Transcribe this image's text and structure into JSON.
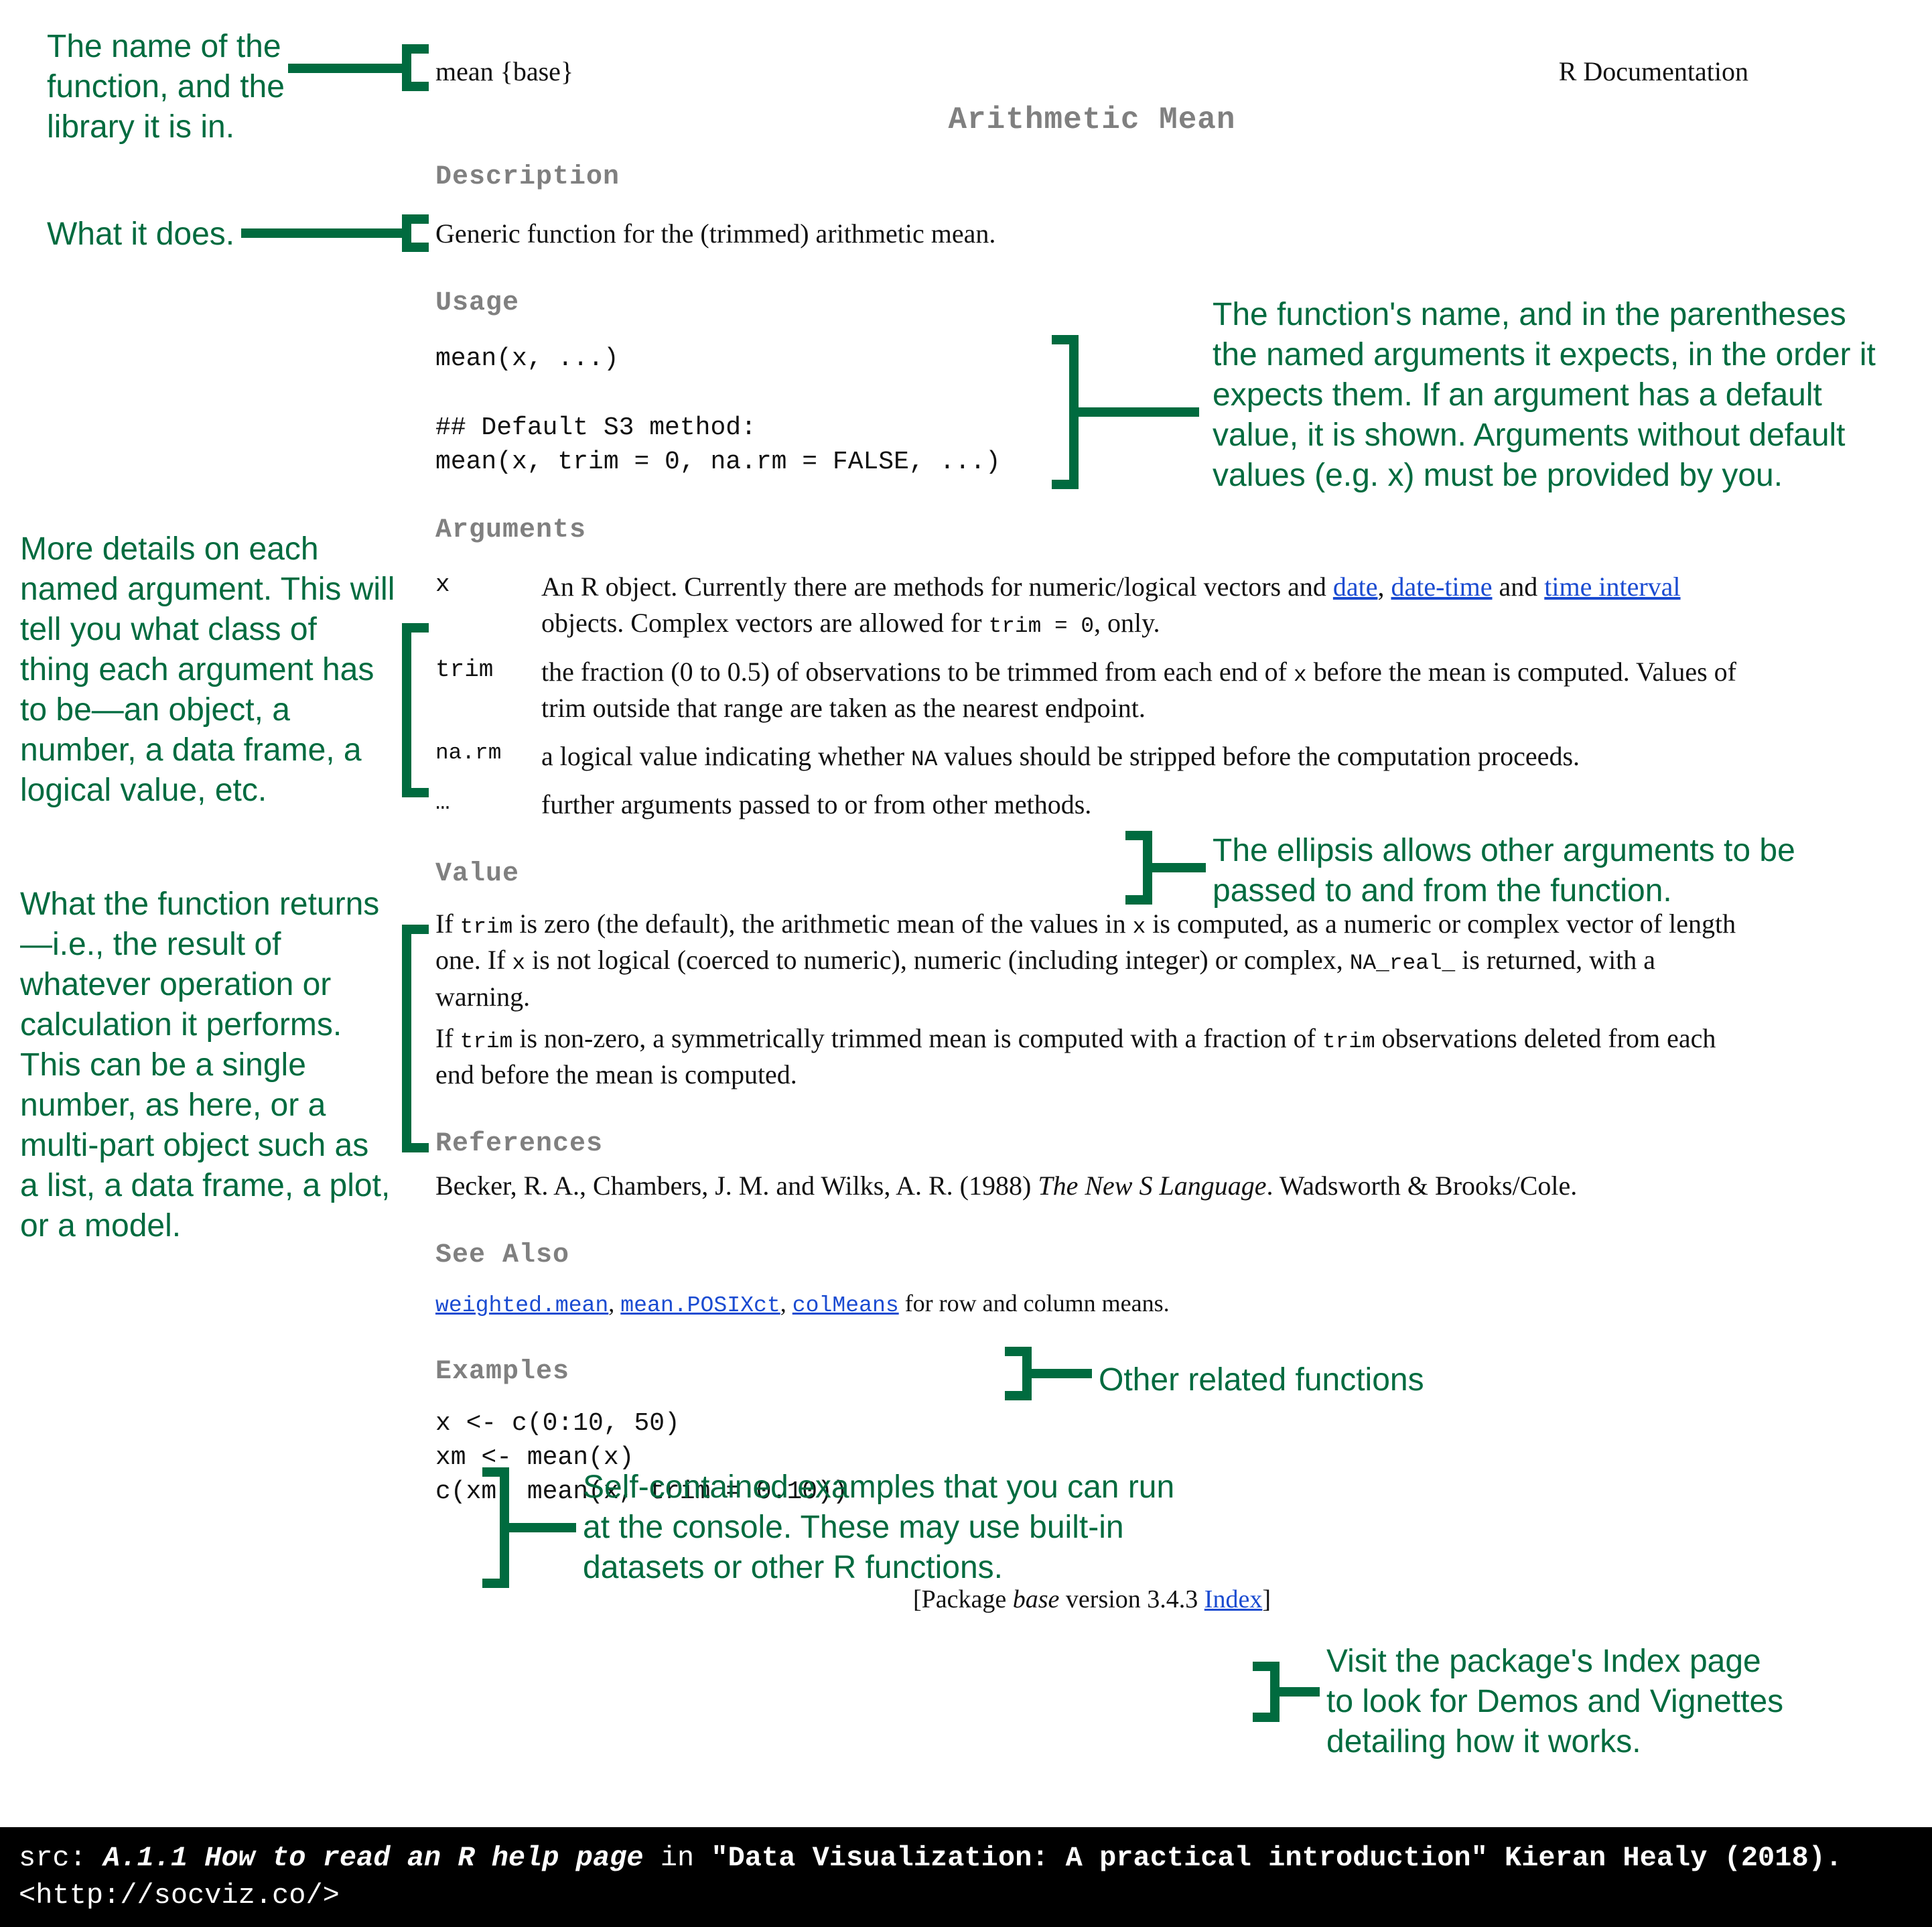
{
  "annotations": {
    "fnname": "The name of the function, and the library it is in.",
    "whatdoes": "What it does.",
    "usage": "The function's name, and in the parentheses the named arguments it expects, in the order it expects them. If an argument has a default value, it is shown. Arguments without default values (e.g. x) must be provided by you.",
    "argdetails": "More details on each named argument. This will tell you what class of thing each argument has to be—an object, a number, a data frame, a logical value, etc.",
    "ellipsis": "The ellipsis allows other arguments to be passed to and from the function.",
    "value": "What the function returns—i.e., the result of whatever operation or calculation it performs. This can be a single number, as here, or a multi-part object such as a list, a data frame, a plot, or a model.",
    "seealso": "Other related functions",
    "examples": "Self-contained examples that you can run at the console. These may use built-in datasets or other R functions.",
    "index": "Visit the package's Index page to look for Demos and Vignettes detailing how it works."
  },
  "doc": {
    "topline_left": "mean {base}",
    "topline_right": "R Documentation",
    "title": "Arithmetic Mean",
    "description_hdr": "Description",
    "description_text": "Generic function for the (trimmed) arithmetic mean.",
    "usage_hdr": "Usage",
    "usage_code": "mean(x, ...)\n\n## Default S3 method:\nmean(x, trim = 0, na.rm = FALSE, ...)",
    "arguments_hdr": "Arguments",
    "args": {
      "x": {
        "name": "x",
        "pre": "An R object. Currently there are methods for numeric/logical vectors and ",
        "link1": "date",
        "mid1": ", ",
        "link2": "date-time",
        "mid2": " and ",
        "link3": "time interval",
        "post": " objects. Complex vectors are allowed for ",
        "code_tail": "trim = 0",
        "tail": ", only."
      },
      "trim": {
        "name": "trim",
        "text_a": "the fraction (0 to 0.5) of observations to be trimmed from each end of ",
        "code_x": "x",
        "text_b": " before the mean is computed. Values of trim outside that range are taken as the nearest endpoint."
      },
      "narm": {
        "name": "na.rm",
        "text_a": "a logical value indicating whether ",
        "code_na": "NA",
        "text_b": " values should be stripped before the computation proceeds."
      },
      "dots": {
        "name": "…",
        "text": "further arguments passed to or from other methods."
      }
    },
    "value_hdr": "Value",
    "value_p1_a": "If ",
    "value_p1_trim": "trim",
    "value_p1_b": " is zero (the default), the arithmetic mean of the values in ",
    "value_p1_x": "x",
    "value_p1_c": " is computed, as a numeric or complex vector of length one. If ",
    "value_p1_x2": "x",
    "value_p1_d": " is not logical (coerced to numeric), numeric (including integer) or complex, ",
    "value_p1_nareal": "NA_real_",
    "value_p1_e": " is returned, with a warning.",
    "value_p2_a": "If ",
    "value_p2_trim": "trim",
    "value_p2_b": " is non-zero, a symmetrically trimmed mean is computed with a fraction of ",
    "value_p2_trim2": "trim",
    "value_p2_c": " observations deleted from each end before the mean is computed.",
    "references_hdr": "References",
    "references_text_a": "Becker, R. A., Chambers, J. M. and Wilks, A. R. (1988) ",
    "references_text_i": "The New S Language",
    "references_text_b": ". Wadsworth & Brooks/Cole.",
    "seealso_hdr": "See Also",
    "seealso_link1": "weighted.mean",
    "seealso_sep1": ", ",
    "seealso_link2": "mean.POSIXct",
    "seealso_sep2": ", ",
    "seealso_link3": "colMeans",
    "seealso_tail": " for row and column means.",
    "examples_hdr": "Examples",
    "examples_code": "x <- c(0:10, 50)\nxm <- mean(x)\nc(xm, mean(x, trim = 0.10))",
    "package_a": "[Package ",
    "package_i": "base",
    "package_b": " version 3.4.3 ",
    "package_link": "Index",
    "package_c": "]"
  },
  "footer": {
    "pre": "src: ",
    "bold1": "A.1.1 How to read an R help page",
    "mid1": " in ",
    "bold2": "\"Data Visualization: A practical introduction\" Kieran Healy (2018).",
    "url": " <http://socviz.co/>"
  }
}
